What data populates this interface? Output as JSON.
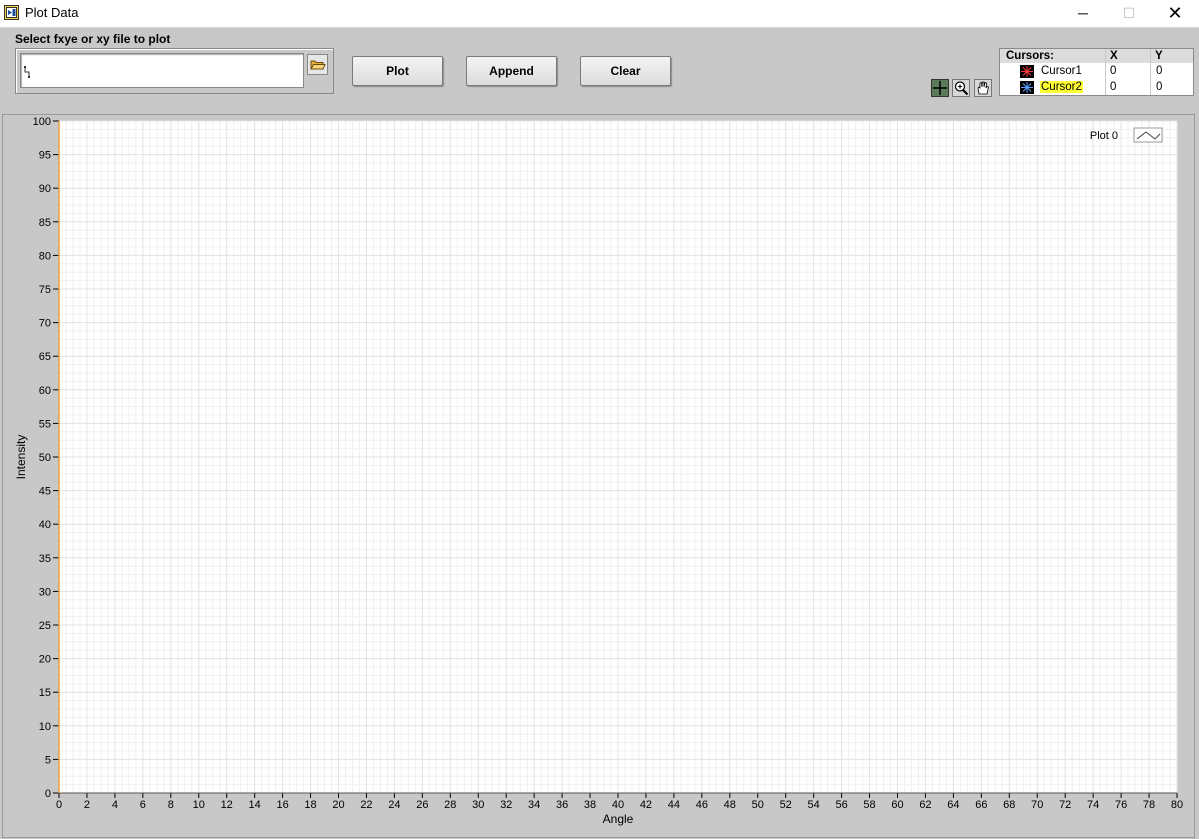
{
  "window": {
    "title": "Plot Data",
    "minimize_glyph": "─",
    "maximize_glyph": "☐",
    "close_glyph": "✕"
  },
  "file_select": {
    "label": "Select fxye or xy file to plot",
    "value": "",
    "browse_icon": "folder-open-icon"
  },
  "buttons": {
    "plot": "Plot",
    "append": "Append",
    "clear": "Clear"
  },
  "graph_tools": [
    "cursor-tool-icon",
    "zoom-tool-icon",
    "pan-hand-icon"
  ],
  "cursors": {
    "header": "Cursors:",
    "col_x": "X",
    "col_y": "Y",
    "rows": [
      {
        "name": "Cursor1",
        "x": "0",
        "y": "0",
        "highlighted": false,
        "color": "#ff3b3b"
      },
      {
        "name": "Cursor2",
        "x": "0",
        "y": "0",
        "highlighted": true,
        "color": "#5aa0ff"
      }
    ]
  },
  "colors": {
    "plot_background": "#ffffff",
    "grid": "#e4e4e4",
    "y_axis_line": "#e8a040",
    "cursor_highlight": "#ffff33"
  },
  "chart_data": {
    "type": "line",
    "xlabel": "Angle",
    "ylabel": "Intensity",
    "xlim": [
      0,
      80
    ],
    "ylim": [
      0,
      100
    ],
    "x_ticks": [
      0,
      2,
      4,
      6,
      8,
      10,
      12,
      14,
      16,
      18,
      20,
      22,
      24,
      26,
      28,
      30,
      32,
      34,
      36,
      38,
      40,
      42,
      44,
      46,
      48,
      50,
      52,
      54,
      56,
      58,
      60,
      62,
      64,
      66,
      68,
      70,
      72,
      74,
      76,
      78,
      80
    ],
    "y_ticks": [
      0,
      5,
      10,
      15,
      20,
      25,
      30,
      35,
      40,
      45,
      50,
      55,
      60,
      65,
      70,
      75,
      80,
      85,
      90,
      95,
      100
    ],
    "series": [
      {
        "name": "Plot 0",
        "x": [],
        "y": []
      }
    ],
    "legend_position": "top-right",
    "grid": true
  }
}
